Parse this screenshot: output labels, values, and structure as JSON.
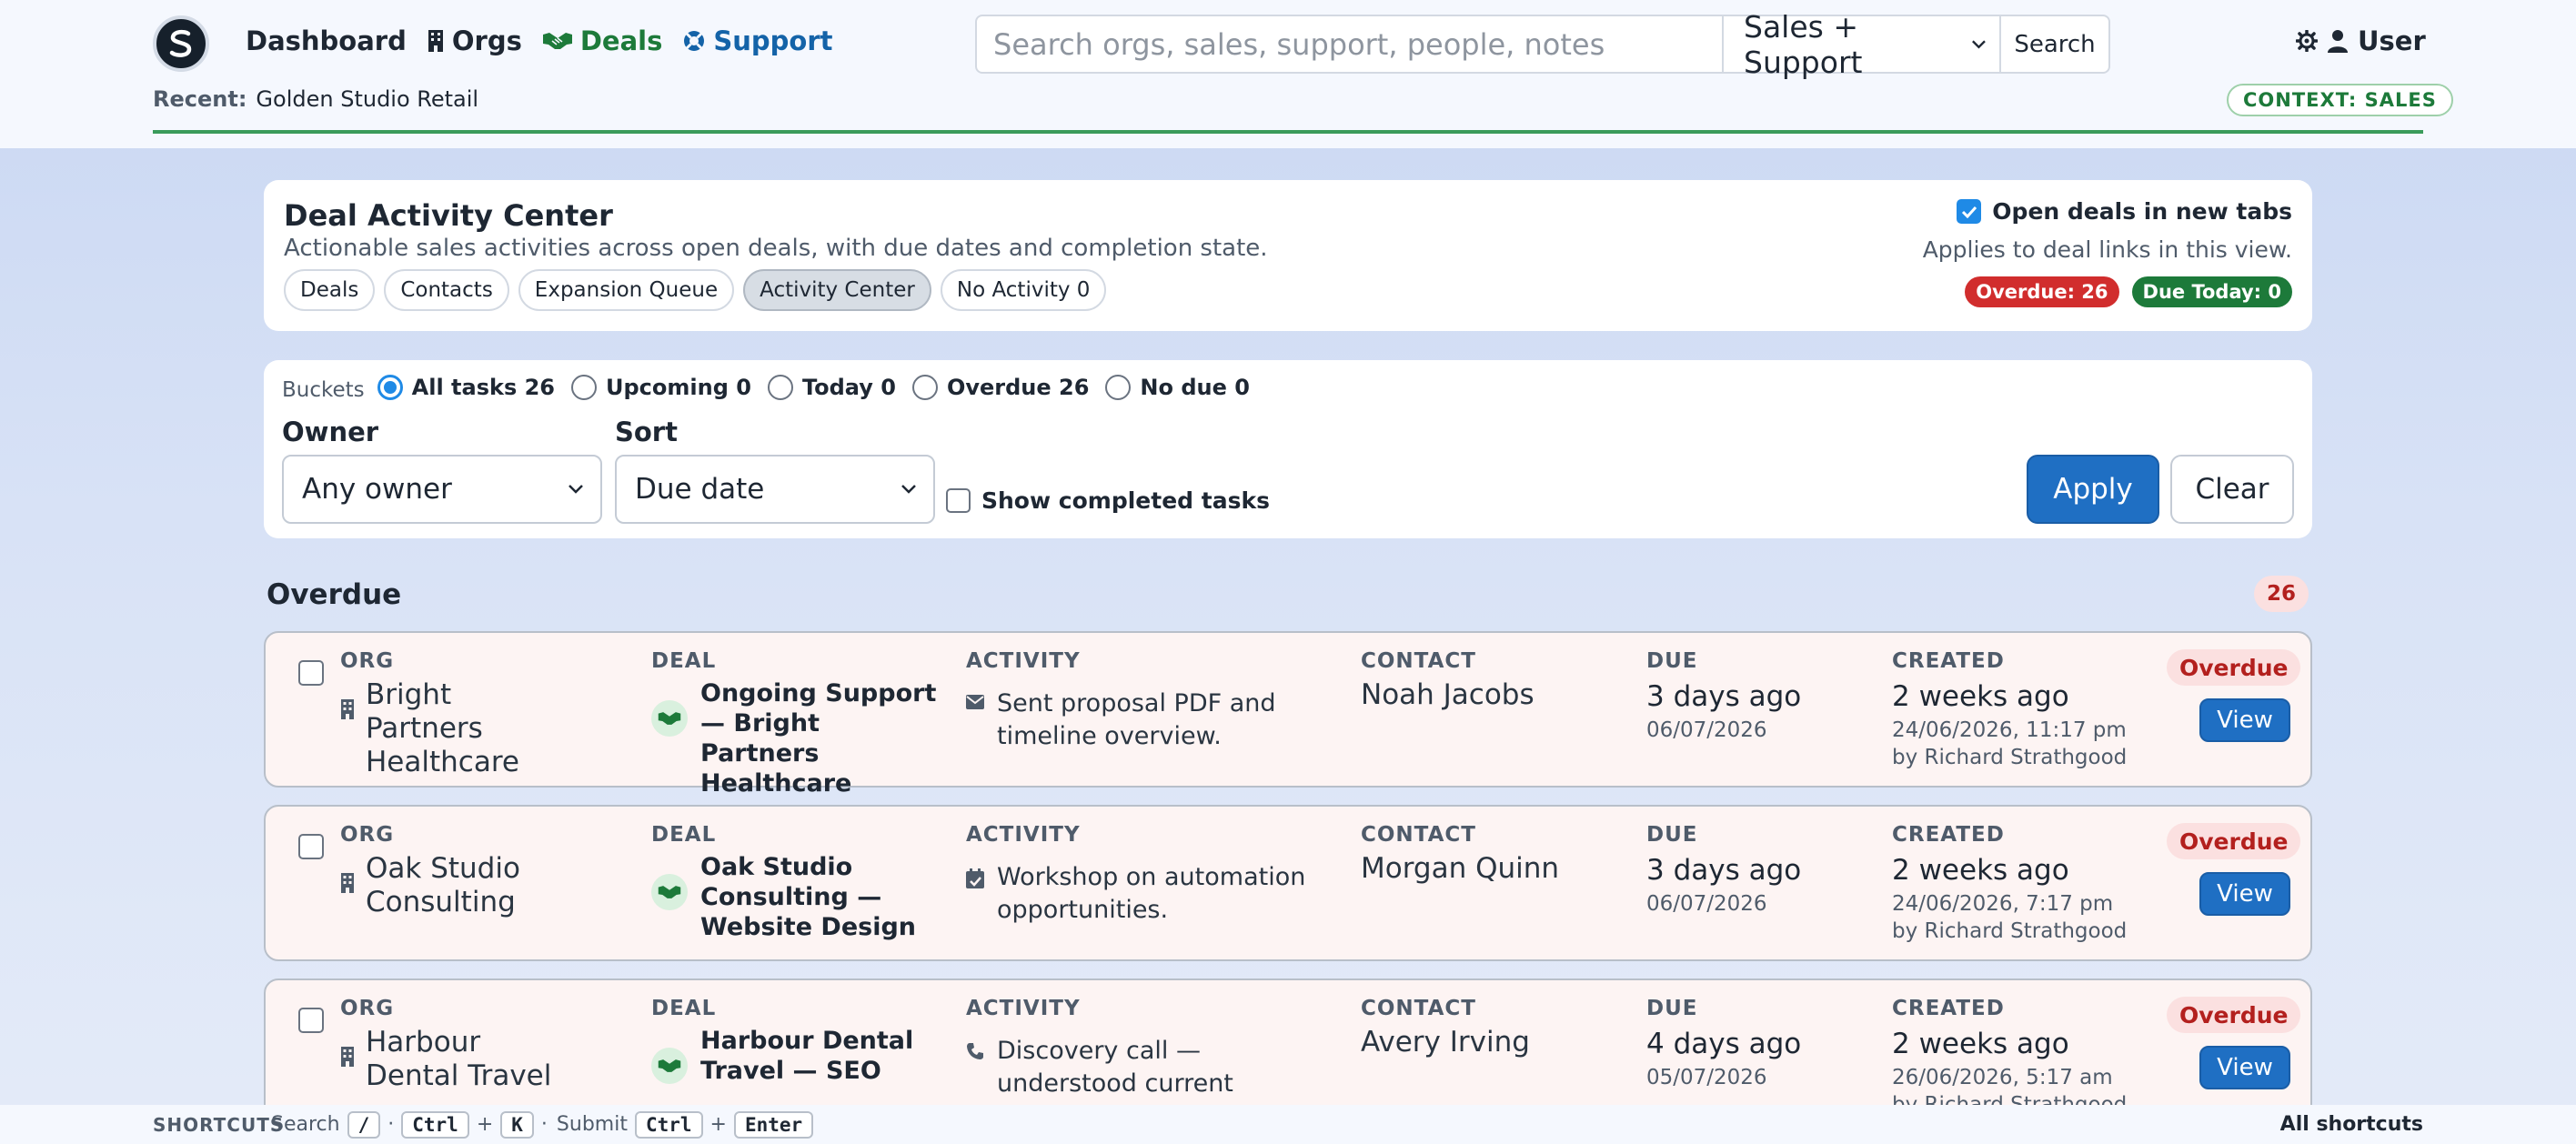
{
  "nav": {
    "dashboard": "Dashboard",
    "orgs": "Orgs",
    "deals": "Deals",
    "support": "Support"
  },
  "search": {
    "placeholder": "Search orgs, sales, support, people, notes",
    "scope": "Sales + Support",
    "button": "Search"
  },
  "user": {
    "label": "User"
  },
  "recent": {
    "label": "Recent:",
    "value": "Golden Studio Retail"
  },
  "context_badge": "CONTEXT: SALES",
  "header": {
    "title": "Deal Activity Center",
    "subtitle": "Actionable sales activities across open deals, with due dates and completion state.",
    "pills": [
      "Deals",
      "Contacts",
      "Expansion Queue",
      "Activity Center",
      "No Activity 0"
    ],
    "active_pill": "Activity Center",
    "open_new_tabs_label": "Open deals in new tabs",
    "open_new_tabs_checked": true,
    "applies_note": "Applies to deal links in this view.",
    "overdue_badge": "Overdue: 26",
    "due_today_badge": "Due Today: 0"
  },
  "filters": {
    "buckets_label": "Buckets",
    "buckets": [
      {
        "label": "All tasks 26",
        "selected": true
      },
      {
        "label": "Upcoming 0",
        "selected": false
      },
      {
        "label": "Today 0",
        "selected": false
      },
      {
        "label": "Overdue 26",
        "selected": false
      },
      {
        "label": "No due 0",
        "selected": false
      }
    ],
    "owner_label": "Owner",
    "owner_value": "Any owner",
    "sort_label": "Sort",
    "sort_value": "Due date",
    "show_completed_label": "Show completed tasks",
    "show_completed_checked": false,
    "apply": "Apply",
    "clear": "Clear"
  },
  "section": {
    "title": "Overdue",
    "count": "26"
  },
  "columns": {
    "org": "ORG",
    "deal": "DEAL",
    "activity": "ACTIVITY",
    "contact": "CONTACT",
    "due": "DUE",
    "created": "CREATED"
  },
  "rows": [
    {
      "org": "Bright Partners Healthcare",
      "deal": "Ongoing Support — Bright Partners Healthcare",
      "activity_icon": "envelope-icon",
      "activity": "Sent proposal PDF and timeline overview.",
      "contact": "Noah Jacobs",
      "due_rel": "3 days ago",
      "due_date": "06/07/2026",
      "created_rel": "2 weeks ago",
      "created_date": "24/06/2026, 11:17 pm",
      "created_by": "by Richard Strathgood",
      "status": "Overdue",
      "view": "View"
    },
    {
      "org": "Oak Studio Consulting",
      "deal": "Oak Studio Consulting — Website Design",
      "activity_icon": "calendar-check-icon",
      "activity": "Workshop on automation opportunities.",
      "contact": "Morgan Quinn",
      "due_rel": "3 days ago",
      "due_date": "06/07/2026",
      "created_rel": "2 weeks ago",
      "created_date": "24/06/2026, 7:17 pm",
      "created_by": "by Richard Strathgood",
      "status": "Overdue",
      "view": "View"
    },
    {
      "org": "Harbour Dental Travel",
      "deal": "Harbour Dental Travel — SEO",
      "activity_icon": "phone-icon",
      "activity": "Discovery call — understood current website and lead…",
      "contact": "Avery Irving",
      "due_rel": "4 days ago",
      "due_date": "05/07/2026",
      "created_rel": "2 weeks ago",
      "created_date": "26/06/2026, 5:17 am",
      "created_by": "by Richard Strathgood",
      "status": "Overdue",
      "view": "View"
    }
  ],
  "footer": {
    "shortcuts_label": "SHORTCUTS",
    "search_label": "Search",
    "key_slash": "/",
    "sep": "·",
    "key_ctrl": "Ctrl",
    "plus": "+",
    "key_k": "K",
    "submit_label": "Submit",
    "key_enter": "Enter",
    "all_shortcuts": "All shortcuts"
  }
}
